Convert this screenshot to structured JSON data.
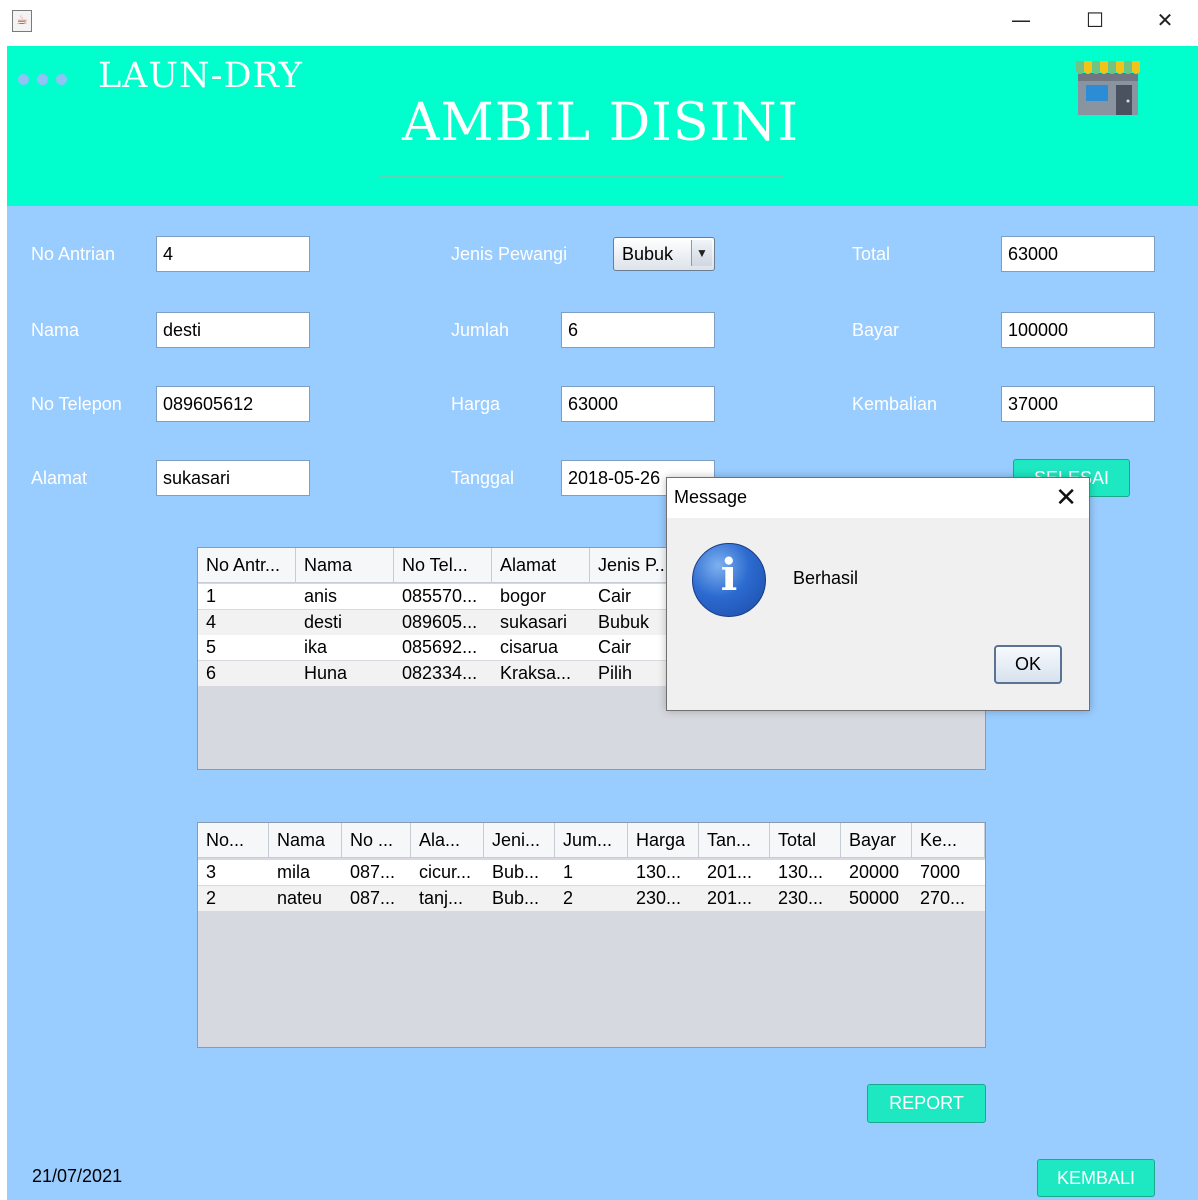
{
  "window": {
    "minimize": "—",
    "maximize": "☐",
    "close": "✕"
  },
  "header": {
    "brand": "LAUN-DRY",
    "heading": "AMBIL DISINI",
    "accent_color": "#00ffcc"
  },
  "form": {
    "no_antrian": {
      "label": "No Antrian",
      "value": "4"
    },
    "nama": {
      "label": "Nama",
      "value": "desti"
    },
    "no_telepon": {
      "label": "No Telepon",
      "value": "089605612"
    },
    "alamat": {
      "label": "Alamat",
      "value": "sukasari"
    },
    "jenis_pewangi": {
      "label": "Jenis Pewangi",
      "value": "Bubuk"
    },
    "jumlah": {
      "label": "Jumlah",
      "value": "6"
    },
    "harga": {
      "label": "Harga",
      "value": "63000"
    },
    "tanggal": {
      "label": "Tanggal",
      "value": "2018-05-26"
    },
    "total": {
      "label": "Total",
      "value": "63000"
    },
    "bayar": {
      "label": "Bayar",
      "value": "100000"
    },
    "kembalian": {
      "label": "Kembalian",
      "value": "37000"
    },
    "selesai_label": "SELESAI"
  },
  "queue_table": {
    "columns": [
      "No Antr...",
      "Nama",
      "No Tel...",
      "Alamat",
      "Jenis P..."
    ],
    "rows": [
      [
        "1",
        "anis",
        "085570...",
        "bogor",
        "Cair"
      ],
      [
        "4",
        "desti",
        "089605...",
        "sukasari",
        "Bubuk"
      ],
      [
        "5",
        "ika",
        "085692...",
        "cisarua",
        "Cair"
      ],
      [
        "6",
        "Huna",
        "082334...",
        "Kraksa...",
        "Pilih"
      ]
    ]
  },
  "done_table": {
    "columns": [
      "No...",
      "Nama",
      "No ...",
      "Ala...",
      "Jeni...",
      "Jum...",
      "Harga",
      "Tan...",
      "Total",
      "Bayar",
      "Ke..."
    ],
    "rows": [
      [
        "3",
        "mila",
        "087...",
        "cicur...",
        "Bub...",
        "1",
        "130...",
        "201...",
        "130...",
        "20000",
        "7000"
      ],
      [
        "2",
        "nateu",
        "087...",
        "tanj...",
        "Bub...",
        "2",
        "230...",
        "201...",
        "230...",
        "50000",
        "270..."
      ]
    ]
  },
  "buttons": {
    "report": "REPORT",
    "kembali": "KEMBALI"
  },
  "footer": {
    "date": "21/07/2021"
  },
  "dialog": {
    "title": "Message",
    "close": "✕",
    "message": "Berhasil",
    "ok": "OK",
    "icon": "info-icon"
  }
}
